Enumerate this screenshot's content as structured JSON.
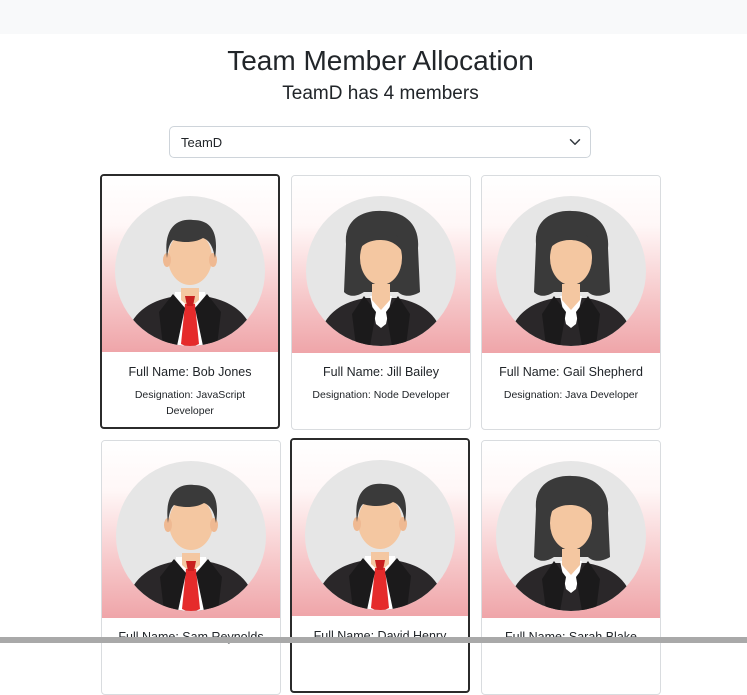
{
  "page": {
    "title": "Team Member Allocation",
    "subtitle": "TeamD has 4 members"
  },
  "team_select": {
    "value": "TeamD",
    "icon": "chevron-down-icon"
  },
  "colors": {
    "selected_border": "#2b2b2b",
    "card_border": "#d9dcdf",
    "gradient_bottom": "#efa5a9"
  },
  "cards": [
    {
      "name": "Full Name: Bob Jones",
      "designation": "Designation: JavaScript Developer",
      "gender": "male",
      "selected": true
    },
    {
      "name": "Full Name: Jill Bailey",
      "designation": "Designation: Node Developer",
      "gender": "female",
      "selected": false
    },
    {
      "name": "Full Name: Gail Shepherd",
      "designation": "Designation: Java Developer",
      "gender": "female",
      "selected": false
    },
    {
      "name": "Full Name: Sam Reynolds",
      "designation": "",
      "gender": "male",
      "selected": false
    },
    {
      "name": "Full Name: David Henry",
      "designation": "",
      "gender": "male",
      "selected": true
    },
    {
      "name": "Full Name: Sarah Blake",
      "designation": "",
      "gender": "female",
      "selected": false
    }
  ]
}
